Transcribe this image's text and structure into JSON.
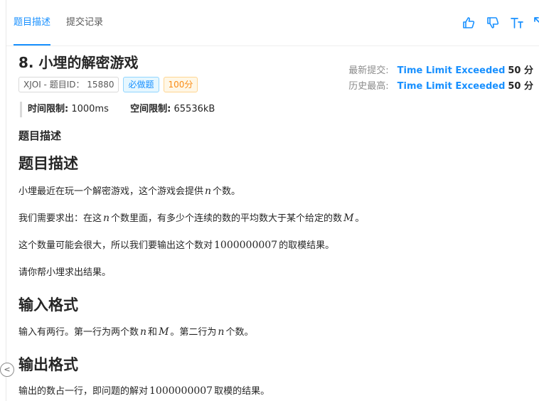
{
  "tabs": {
    "description": "题目描述",
    "submissions": "提交记录"
  },
  "toolbar": {
    "like_icon": "thumbs-up-icon",
    "dislike_icon": "thumbs-down-icon",
    "font_icon": "font-size-icon",
    "expand_icon": "expand-icon"
  },
  "problem": {
    "title": "8.  小埋的解密游戏",
    "source_badge": "XJOI - 题目ID： 15880",
    "required_badge": "必做题",
    "score_badge": "100分",
    "latest_label": "最新提交:",
    "latest_status": "Time Limit Exceeded",
    "latest_score": "50 分",
    "best_label": "历史最高:",
    "best_status": "Time Limit Exceeded",
    "best_score": "50 分",
    "time_limit_label": "时间限制:",
    "time_limit_value": "1000ms",
    "memory_limit_label": "空间限制:",
    "memory_limit_value": "65536kB"
  },
  "content": {
    "section_small": "题目描述",
    "section_desc": "题目描述",
    "p1_a": "小埋最近在玩一个解密游戏，这个游戏会提供",
    "p1_var": "n",
    "p1_b": "个数。",
    "p2_a": "我们需要求出：在这",
    "p2_var1": "n",
    "p2_b": "个数里面，有多少个连续的数的平均数大于某个给定的数",
    "p2_var2": "M",
    "p2_c": "。",
    "p3_a": "这个数量可能会很大，所以我们要输出这个数对",
    "p3_num": "1000000007",
    "p3_b": "的取模结果。",
    "p4": "请你帮小埋求出结果。",
    "section_input": "输入格式",
    "in_a": "输入有两行。第一行为两个数",
    "in_var1": "n",
    "in_b": "和",
    "in_var2": "M",
    "in_c": "。第二行为",
    "in_var3": "n",
    "in_d": "个数。",
    "section_output": "输出格式",
    "out_a": "输出的数占一行，即问题的解对",
    "out_num": "1000000007",
    "out_b": "取模的结果。"
  },
  "colors": {
    "accent": "#1890ff",
    "orange": "#fa8c16"
  }
}
